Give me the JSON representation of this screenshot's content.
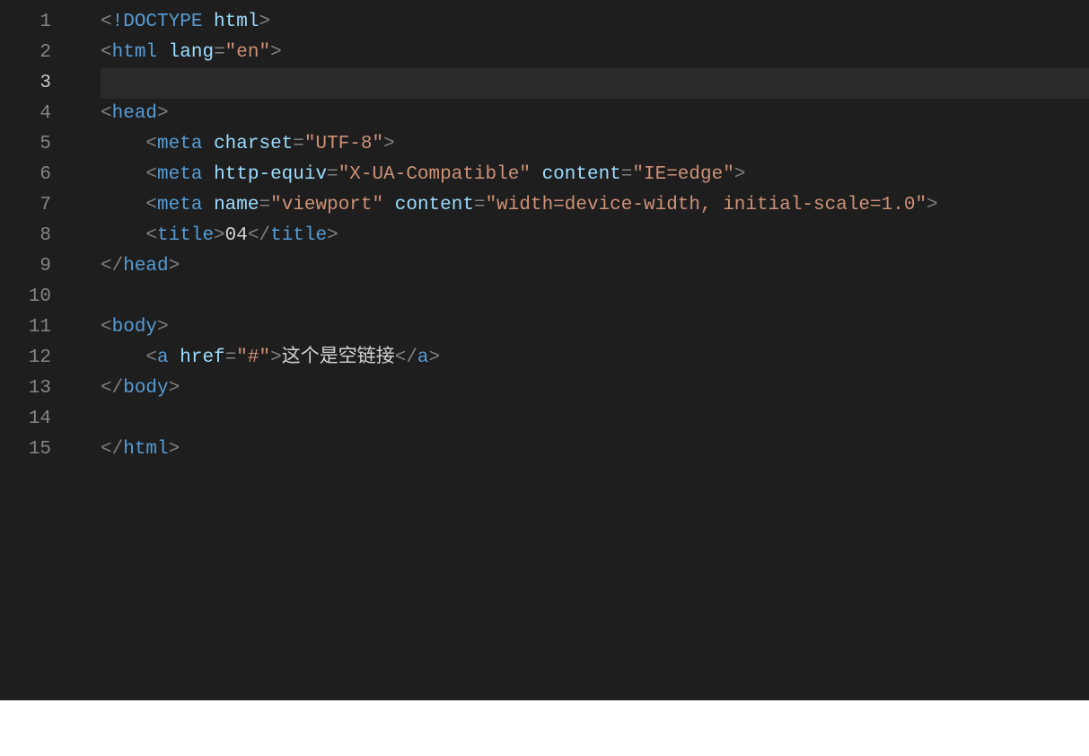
{
  "editor": {
    "tab_size": 4,
    "active_line": 3,
    "language": "html",
    "total_lines": 15
  },
  "gutter": [
    "1",
    "2",
    "3",
    "4",
    "5",
    "6",
    "7",
    "8",
    "9",
    "10",
    "11",
    "12",
    "13",
    "14",
    "15"
  ],
  "tokens": {
    "lt": "<",
    "gt": ">",
    "slash": "/",
    "eq": "=",
    "bang_doctype": "!DOCTYPE",
    "space": " ",
    "indent1": "    ",
    "html_kw": "html",
    "lang_attr": "lang",
    "lang_val": "\"en\"",
    "head_kw": "head",
    "meta_kw": "meta",
    "charset_attr": "charset",
    "charset_val": "\"UTF-8\"",
    "httpequiv_attr": "http-equiv",
    "httpequiv_val": "\"X-UA-Compatible\"",
    "content_attr": "content",
    "content_val_ie": "\"IE=edge\"",
    "name_attr": "name",
    "name_val_vp": "\"viewport\"",
    "content_val_vp": "\"width=device-width, initial-scale=1.0\"",
    "title_kw": "title",
    "title_text": "04",
    "body_kw": "body",
    "a_kw": "a",
    "href_attr": "href",
    "href_val": "\"#\"",
    "link_text": "这个是空链接"
  }
}
